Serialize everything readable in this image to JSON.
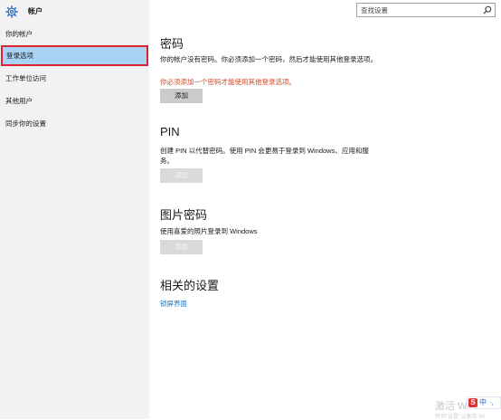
{
  "app": {
    "title": "帐户"
  },
  "search": {
    "placeholder": "查找设置"
  },
  "sidebar": {
    "items": [
      {
        "label": "你的帐户"
      },
      {
        "label": "登录选项",
        "selected": true
      },
      {
        "label": "工作单位访问"
      },
      {
        "label": "其他用户"
      },
      {
        "label": "同步你的设置"
      }
    ]
  },
  "main": {
    "password": {
      "title": "密码",
      "description": "你的帐户没有密码。你必须添加一个密码，然后才能使用其他登录选项。",
      "warning": "你必须添加一个密码才能使用其他登录选项。",
      "button": "添加"
    },
    "pin": {
      "title": "PIN",
      "description": "创建 PIN 以代替密码。使用 PIN 会更易于登录到 Windows、应用和服务。",
      "button": "添加"
    },
    "picture_password": {
      "title": "图片密码",
      "description": "使用喜爱的照片登录到 Windows",
      "button": "添加"
    },
    "related": {
      "title": "相关的设置",
      "link": "锁屏界面"
    }
  },
  "overlay": {
    "watermark": "激活 Wi",
    "watermark_sub": "转到\"设置\"以激活 Wi",
    "ime_logo": "S",
    "ime_label": "中",
    "ime_extra": "·,"
  },
  "colors": {
    "accent": "#1a73c9",
    "warning": "#d24726",
    "selected_bg": "#a9d3f5",
    "selected_border": "#d9242e"
  }
}
